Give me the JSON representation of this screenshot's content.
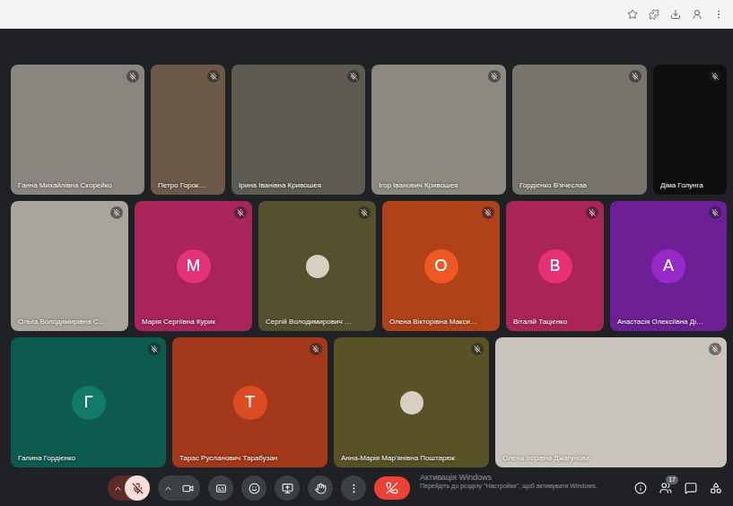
{
  "tile_rows": [
    [
      {
        "name": "Ганна Михайлівна Скорейко",
        "kind": "video",
        "color": "#8a857e",
        "muted": true
      },
      {
        "name": "Петро Горок…",
        "kind": "video",
        "color": "#6b5a47",
        "muted": true
      },
      {
        "name": "Ірина Іванівна Кривошея",
        "kind": "video",
        "color": "#5e5b52",
        "muted": true
      },
      {
        "name": "Ігор Іванович Кривошея",
        "kind": "video",
        "color": "#8c897f",
        "muted": true
      },
      {
        "name": "Гордієнко В'ячеслав",
        "kind": "video",
        "color": "#77746c",
        "muted": true
      },
      {
        "name": "Діма Голунга",
        "kind": "off",
        "color": "#0e0e0f",
        "muted": true
      }
    ],
    [
      {
        "name": "Ольга Володимирівна С…",
        "kind": "video",
        "color": "#a9a59c",
        "muted": true
      },
      {
        "name": "Марія Сергіївна Курик",
        "kind": "avatar",
        "letter": "M",
        "color": "#a8245a",
        "muted": true
      },
      {
        "name": "Сергій Володимирович …",
        "kind": "photo",
        "color": "#55502e",
        "muted": true
      },
      {
        "name": "Олена Вікторівна Макси…",
        "kind": "avatar",
        "letter": "O",
        "color": "#b0421a",
        "muted": true
      },
      {
        "name": "Віталій Тацієнко",
        "kind": "avatar",
        "letter": "B",
        "color": "#ab2456",
        "muted": true
      },
      {
        "name": "Анастасія Олексіївна Ді…",
        "kind": "avatar",
        "letter": "A",
        "color": "#6e1f95",
        "muted": true
      }
    ],
    [
      {
        "name": "Галина Гордієнко",
        "kind": "avatar",
        "letter": "Г",
        "color": "#0d5a4e",
        "muted": true
      },
      {
        "name": "Тарас Русланович Тарабузан",
        "kind": "avatar",
        "letter": "T",
        "color": "#a3381a",
        "muted": true
      },
      {
        "name": "Анна-Марія Мар'янівна Поштарюк",
        "kind": "photo",
        "color": "#5a5227",
        "muted": true
      },
      {
        "name": "Олена Ігорівна Джагунова",
        "kind": "video",
        "color": "#c9c4bc",
        "muted": true
      }
    ]
  ],
  "controls": {
    "mic_muted": true
  },
  "side_buttons": {
    "people_badge": "17"
  },
  "watermark": {
    "title": "Активація Windows",
    "text": "Перейдіть до розділу \"Настройки\", щоб активувати Windows."
  }
}
